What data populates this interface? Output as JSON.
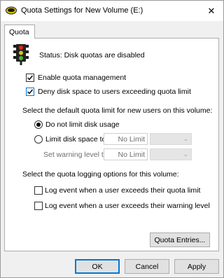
{
  "window": {
    "title": "Quota Settings for New Volume (E:)",
    "close_glyph": "✕",
    "title_icon": "drive-icon"
  },
  "tabs": [
    {
      "label": "Quota",
      "selected": true
    }
  ],
  "status": {
    "icon": "traffic-light-icon",
    "text": "Status:  Disk quotas are disabled"
  },
  "options": {
    "enable_quota": {
      "label": "Enable quota management",
      "checked": true
    },
    "deny_disk": {
      "label": "Deny disk space to users exceeding quota limit",
      "checked": true
    }
  },
  "default_limit": {
    "heading": "Select the default quota limit for new users on this volume:",
    "do_not_limit": {
      "label": "Do not limit disk usage",
      "selected": true
    },
    "limit_disk": {
      "label": "Limit disk space to",
      "selected": false,
      "value": "No Limit"
    },
    "warning_level": {
      "label": "Set warning level to",
      "value": "No Limit"
    }
  },
  "logging": {
    "heading": "Select the quota logging options for this volume:",
    "log_quota": {
      "label": "Log event when a user exceeds their quota limit",
      "checked": false
    },
    "log_warning": {
      "label": "Log event when a user exceeds their warning level",
      "checked": false
    }
  },
  "buttons": {
    "quota_entries": "Quota Entries...",
    "ok": "OK",
    "cancel": "Cancel",
    "apply": "Apply"
  },
  "colors": {
    "accent": "#0078d7",
    "window_bg": "#f0f0f0",
    "panel_bg": "#ffffff",
    "disabled_text": "#6d6d6d"
  }
}
